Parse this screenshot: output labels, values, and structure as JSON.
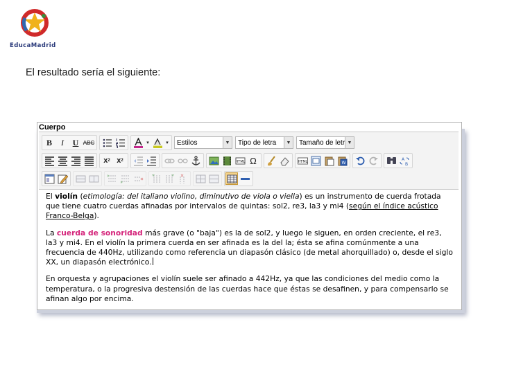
{
  "logo": {
    "text": "EducaMadrid"
  },
  "caption": "El resultado sería el siguiente:",
  "editor": {
    "field_label": "Cuerpo",
    "toolbar": {
      "bold": "B",
      "italic": "I",
      "underline": "U",
      "strike": "ABC",
      "styles": "Estilos",
      "font": "Tipo de letra",
      "size": "Tamaño de letra",
      "subscript": "x",
      "superscript": "x",
      "html_label": "HTML",
      "source_label": "HTML"
    },
    "paragraphs": {
      "p1": {
        "a": "El ",
        "violin": "violín",
        "b": " (",
        "etym": "etimología: del italiano violino, diminutivo de viola o viella",
        "c": ") es un instrumento de cuerda frotada que tiene cuatro cuerdas afinadas por intervalos de quintas: sol2, re3, la3 y mi4 (",
        "link": "según el índice acústico Franco-Belga",
        "d": ")."
      },
      "p2": {
        "a": "La ",
        "highlight": "cuerda de sonoridad",
        "b": " más grave (o \"baja\") es la de sol2, y luego le siguen, en orden creciente, el re3, la3 y mi4. En el violín la primera cuerda en ser afinada es la del la; ésta se afina comúnmente a una frecuencia de 440Hz, utilizando como referencia un diapasón clásico (de metal ahorquillado) o, desde el siglo XX, un diapasón electrónico."
      },
      "p3": "En orquesta y agrupaciones el violín suele ser afinado a 442Hz, ya que las condiciones del medio como la temperatura, o la progresiva destensión de las cuerdas hace que éstas se desafinen, y para compensarlo se afinan algo por encima."
    }
  }
}
